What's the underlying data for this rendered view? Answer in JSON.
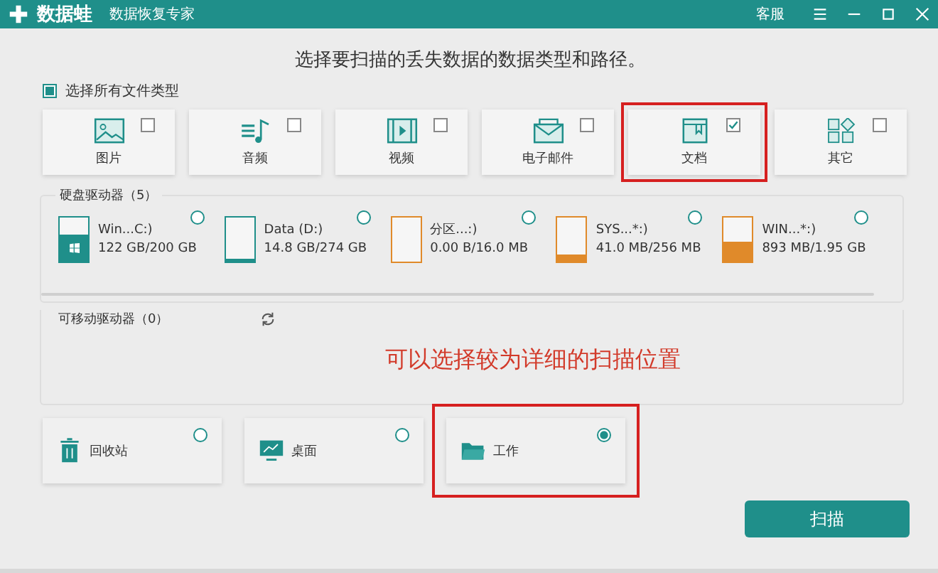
{
  "window": {
    "app_name": "数据蛙",
    "subtitle": "数据恢复专家",
    "service": "客服"
  },
  "heading": "选择要扫描的丢失数据的数据类型和路径。",
  "select_all": {
    "label": "选择所有文件类型",
    "checked": true
  },
  "file_types": [
    {
      "kind": "image",
      "label": "图片",
      "checked": false,
      "highlighted": false
    },
    {
      "kind": "audio",
      "label": "音频",
      "checked": false,
      "highlighted": false
    },
    {
      "kind": "video",
      "label": "视频",
      "checked": false,
      "highlighted": false
    },
    {
      "kind": "email",
      "label": "电子邮件",
      "checked": false,
      "highlighted": false
    },
    {
      "kind": "document",
      "label": "文档",
      "checked": true,
      "highlighted": true
    },
    {
      "kind": "other",
      "label": "其它",
      "checked": false,
      "highlighted": false
    }
  ],
  "hard_drives": {
    "title": "硬盘驱动器（5）",
    "drives": [
      {
        "name": "Win...C:)",
        "usage": "122 GB/200 GB",
        "level": 0.6,
        "color": "#1f8f8a",
        "system": true,
        "selected": false
      },
      {
        "name": "Data (D:)",
        "usage": "14.8 GB/274 GB",
        "level": 0.05,
        "color": "#1f8f8a",
        "system": false,
        "selected": false
      },
      {
        "name": "分区...:)",
        "usage": "0.00  B/16.0 MB",
        "level": 0,
        "color": "#e08a2a",
        "system": false,
        "selected": false
      },
      {
        "name": "SYS...*:)",
        "usage": "41.0 MB/256 MB",
        "level": 0.16,
        "color": "#e08a2a",
        "system": false,
        "selected": false
      },
      {
        "name": "WIN...*:)",
        "usage": "893 MB/1.95 GB",
        "level": 0.45,
        "color": "#e08a2a",
        "system": false,
        "selected": false
      }
    ]
  },
  "removable": {
    "title": "可移动驱动器（0）"
  },
  "annotation": "可以选择较为详细的扫描位置",
  "locations": [
    {
      "kind": "trash",
      "label": "回收站",
      "selected": false,
      "highlighted": false
    },
    {
      "kind": "desktop",
      "label": "桌面",
      "selected": false,
      "highlighted": false
    },
    {
      "kind": "folder",
      "label": "工作",
      "selected": true,
      "highlighted": true
    }
  ],
  "scan_button": "扫描"
}
